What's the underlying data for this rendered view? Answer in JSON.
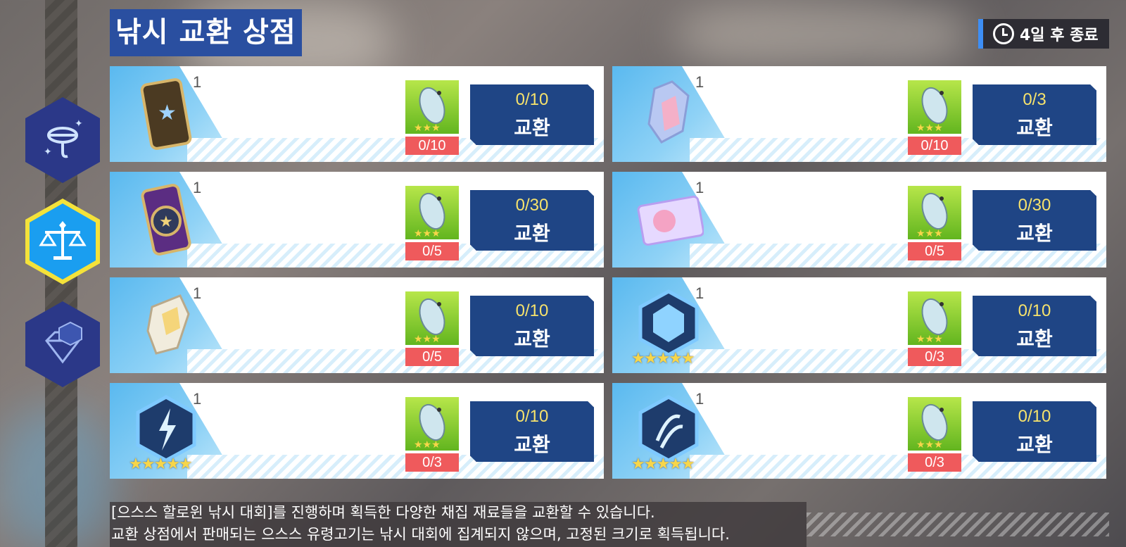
{
  "title": "낚시 교환 상점",
  "timer": {
    "text": "4일 후 종료",
    "icon": "stopwatch-icon"
  },
  "tabs": [
    {
      "name": "tab-fishing",
      "icon": "fishing-hook-icon",
      "selected": false
    },
    {
      "name": "tab-exchange",
      "icon": "scales-icon",
      "selected": true
    },
    {
      "name": "tab-gem",
      "icon": "diamond-icon",
      "selected": false
    }
  ],
  "items": [
    {
      "icon": "star-card-icon",
      "qty": "1",
      "cost_count": "0/10",
      "limit": "0/10",
      "button": "교환",
      "stars": ""
    },
    {
      "icon": "crystal-cluster-icon",
      "qty": "1",
      "cost_count": "0/10",
      "limit": "0/3",
      "button": "교환",
      "stars": ""
    },
    {
      "icon": "compass-card-icon",
      "qty": "1",
      "cost_count": "0/5",
      "limit": "0/30",
      "button": "교환",
      "stars": ""
    },
    {
      "icon": "character-ticket-icon",
      "qty": "1",
      "cost_count": "0/5",
      "limit": "0/30",
      "button": "교환",
      "stars": ""
    },
    {
      "icon": "ore-chunk-icon",
      "qty": "1",
      "cost_count": "0/5",
      "limit": "0/10",
      "button": "교환",
      "stars": ""
    },
    {
      "icon": "ice-emblem-icon",
      "qty": "1",
      "cost_count": "0/3",
      "limit": "0/10",
      "button": "교환",
      "stars": "★★★★★"
    },
    {
      "icon": "lightning-emblem-icon",
      "qty": "1",
      "cost_count": "0/3",
      "limit": "0/10",
      "button": "교환",
      "stars": "★★★★★"
    },
    {
      "icon": "wind-emblem-icon",
      "qty": "1",
      "cost_count": "0/3",
      "limit": "0/10",
      "button": "교환",
      "stars": "★★★★★"
    }
  ],
  "cost_icon": "fish-icon",
  "cost_fish_stars": "★★★",
  "note": {
    "line1": "[으스스 할로윈 낚시 대회]를 진행하며 획득한 다양한 채집 재료들을 교환할 수 있습니다.",
    "line2": "교환 상점에서 판매되는 으스스 유령고기는 낚시 대회에 집계되지 않으며, 고정된 크기로 획득됩니다."
  }
}
